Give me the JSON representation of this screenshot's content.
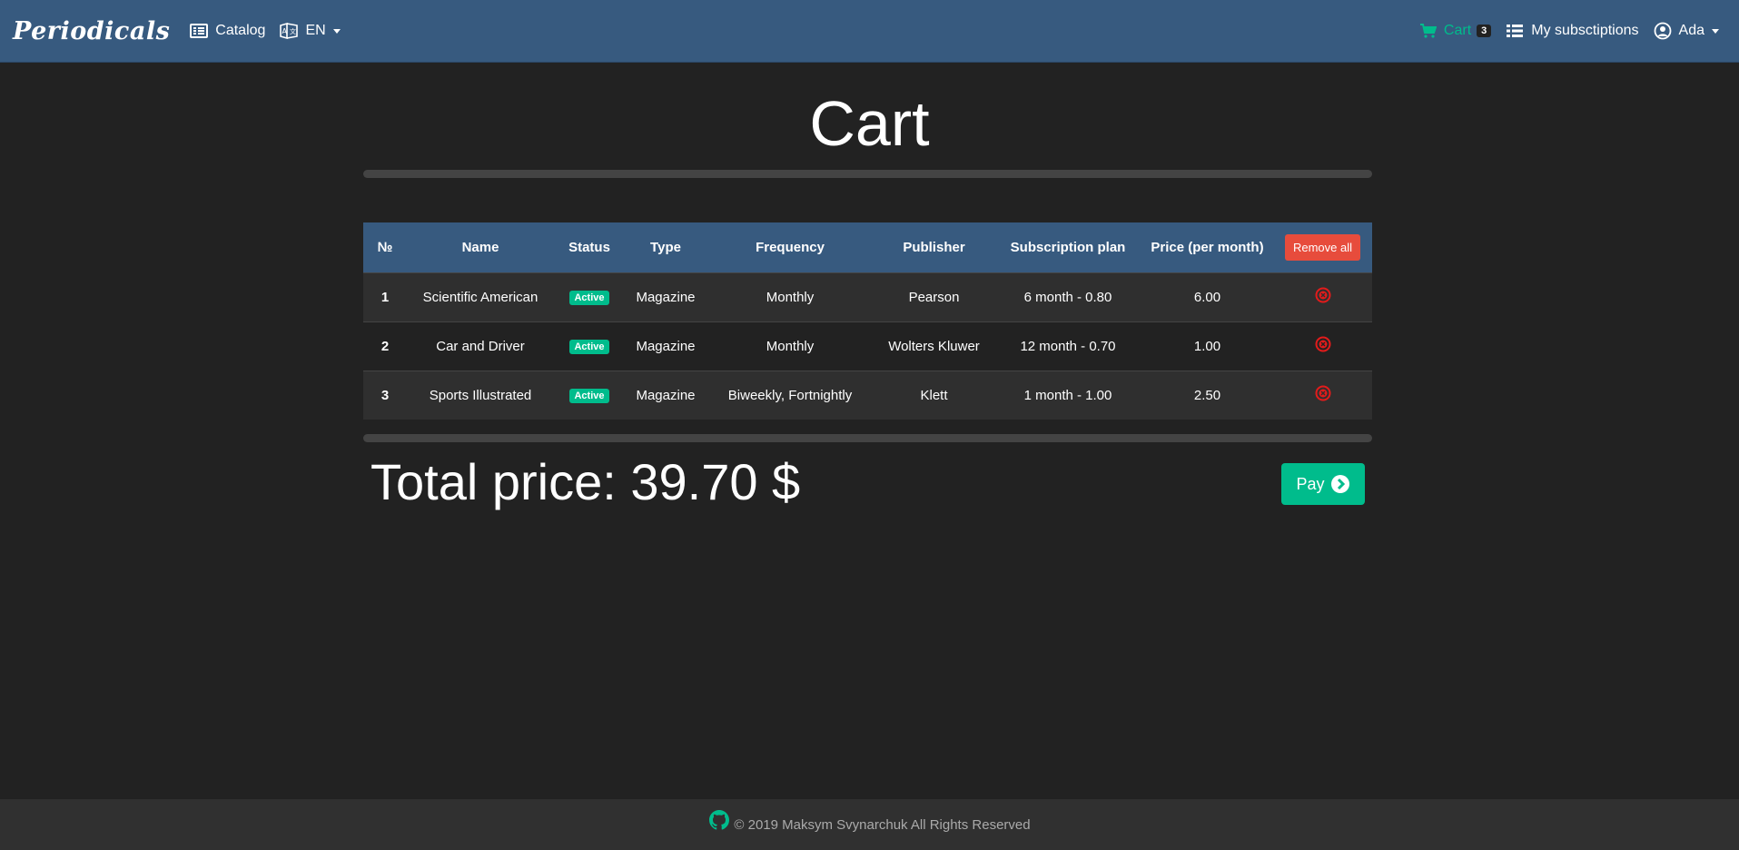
{
  "navbar": {
    "brand": "Periodicals",
    "catalog_label": "Catalog",
    "language_label": "EN",
    "cart_label": "Cart",
    "cart_count": "3",
    "subscriptions_label": "My subsctiptions",
    "user_label": "Ada"
  },
  "page": {
    "title": "Cart"
  },
  "table": {
    "headers": {
      "num": "№",
      "name": "Name",
      "status": "Status",
      "type": "Type",
      "frequency": "Frequency",
      "publisher": "Publisher",
      "plan": "Subscription plan",
      "price": "Price (per month)"
    },
    "remove_all_label": "Remove all",
    "rows": [
      {
        "num": "1",
        "name": "Scientific American",
        "status": "Active",
        "type": "Magazine",
        "frequency": "Monthly",
        "publisher": "Pearson",
        "plan": "6 month - 0.80",
        "price": "6.00"
      },
      {
        "num": "2",
        "name": "Car and Driver",
        "status": "Active",
        "type": "Magazine",
        "frequency": "Monthly",
        "publisher": "Wolters Kluwer",
        "plan": "12 month - 0.70",
        "price": "1.00"
      },
      {
        "num": "3",
        "name": "Sports Illustrated",
        "status": "Active",
        "type": "Magazine",
        "frequency": "Biweekly, Fortnightly",
        "publisher": "Klett",
        "plan": "1 month - 1.00",
        "price": "2.50"
      }
    ]
  },
  "summary": {
    "total_text": "Total price: 39.70 $",
    "pay_label": "Pay"
  },
  "footer": {
    "text": "© 2019 Maksym Svynarchuk All Rights Reserved"
  },
  "colors": {
    "navbar": "#375a7f",
    "background": "#222222",
    "success": "#00bc8c",
    "danger": "#e74c3c"
  }
}
